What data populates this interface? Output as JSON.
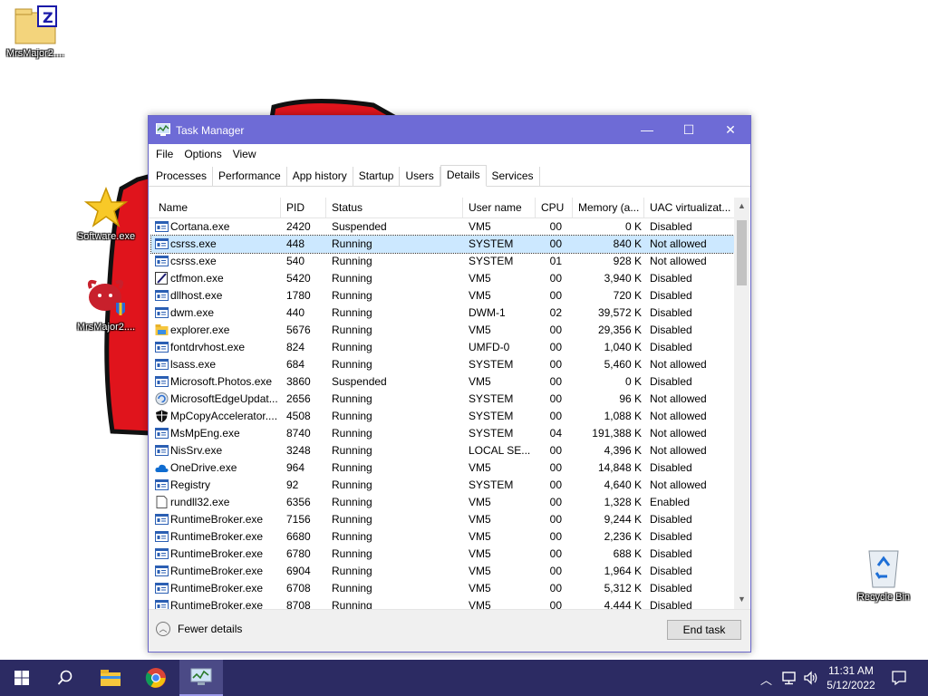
{
  "desktop": {
    "icons": [
      {
        "label": "MrsMajor2...."
      },
      {
        "label": "Software.exe"
      },
      {
        "label": "MrsMajor2...."
      },
      {
        "label": "Recycle Bin"
      }
    ]
  },
  "window": {
    "title": "Task Manager",
    "controls": {
      "minimize": "—",
      "maximize": "☐",
      "close": "✕"
    },
    "menu": [
      "File",
      "Options",
      "View"
    ],
    "tabs": [
      "Processes",
      "Performance",
      "App history",
      "Startup",
      "Users",
      "Details",
      "Services"
    ],
    "active_tab": "Details",
    "columns": [
      "Name",
      "PID",
      "Status",
      "User name",
      "CPU",
      "Memory (a...",
      "UAC virtualizat..."
    ],
    "sort_indicator": "^",
    "rows": [
      {
        "name": "Cortana.exe",
        "pid": "2420",
        "status": "Suspended",
        "user": "VM5",
        "cpu": "00",
        "mem": "0 K",
        "uac": "Disabled",
        "icon": "generic-app"
      },
      {
        "name": "csrss.exe",
        "pid": "448",
        "status": "Running",
        "user": "SYSTEM",
        "cpu": "00",
        "mem": "840 K",
        "uac": "Not allowed",
        "icon": "generic-app"
      },
      {
        "name": "csrss.exe",
        "pid": "540",
        "status": "Running",
        "user": "SYSTEM",
        "cpu": "01",
        "mem": "928 K",
        "uac": "Not allowed",
        "icon": "generic-app"
      },
      {
        "name": "ctfmon.exe",
        "pid": "5420",
        "status": "Running",
        "user": "VM5",
        "cpu": "00",
        "mem": "3,940 K",
        "uac": "Disabled",
        "icon": "pen"
      },
      {
        "name": "dllhost.exe",
        "pid": "1780",
        "status": "Running",
        "user": "VM5",
        "cpu": "00",
        "mem": "720 K",
        "uac": "Disabled",
        "icon": "generic-app"
      },
      {
        "name": "dwm.exe",
        "pid": "440",
        "status": "Running",
        "user": "DWM-1",
        "cpu": "02",
        "mem": "39,572 K",
        "uac": "Disabled",
        "icon": "generic-app"
      },
      {
        "name": "explorer.exe",
        "pid": "5676",
        "status": "Running",
        "user": "VM5",
        "cpu": "00",
        "mem": "29,356 K",
        "uac": "Disabled",
        "icon": "folder"
      },
      {
        "name": "fontdrvhost.exe",
        "pid": "824",
        "status": "Running",
        "user": "UMFD-0",
        "cpu": "00",
        "mem": "1,040 K",
        "uac": "Disabled",
        "icon": "generic-app"
      },
      {
        "name": "lsass.exe",
        "pid": "684",
        "status": "Running",
        "user": "SYSTEM",
        "cpu": "00",
        "mem": "5,460 K",
        "uac": "Not allowed",
        "icon": "generic-app"
      },
      {
        "name": "Microsoft.Photos.exe",
        "pid": "3860",
        "status": "Suspended",
        "user": "VM5",
        "cpu": "00",
        "mem": "0 K",
        "uac": "Disabled",
        "icon": "generic-app"
      },
      {
        "name": "MicrosoftEdgeUpdat...",
        "pid": "2656",
        "status": "Running",
        "user": "SYSTEM",
        "cpu": "00",
        "mem": "96 K",
        "uac": "Not allowed",
        "icon": "edge-update"
      },
      {
        "name": "MpCopyAccelerator....",
        "pid": "4508",
        "status": "Running",
        "user": "SYSTEM",
        "cpu": "00",
        "mem": "1,088 K",
        "uac": "Not allowed",
        "icon": "shield"
      },
      {
        "name": "MsMpEng.exe",
        "pid": "8740",
        "status": "Running",
        "user": "SYSTEM",
        "cpu": "04",
        "mem": "191,388 K",
        "uac": "Not allowed",
        "icon": "generic-app"
      },
      {
        "name": "NisSrv.exe",
        "pid": "3248",
        "status": "Running",
        "user": "LOCAL SE...",
        "cpu": "00",
        "mem": "4,396 K",
        "uac": "Not allowed",
        "icon": "generic-app"
      },
      {
        "name": "OneDrive.exe",
        "pid": "964",
        "status": "Running",
        "user": "VM5",
        "cpu": "00",
        "mem": "14,848 K",
        "uac": "Disabled",
        "icon": "cloud"
      },
      {
        "name": "Registry",
        "pid": "92",
        "status": "Running",
        "user": "SYSTEM",
        "cpu": "00",
        "mem": "4,640 K",
        "uac": "Not allowed",
        "icon": "generic-app"
      },
      {
        "name": "rundll32.exe",
        "pid": "6356",
        "status": "Running",
        "user": "VM5",
        "cpu": "00",
        "mem": "1,328 K",
        "uac": "Enabled",
        "icon": "document"
      },
      {
        "name": "RuntimeBroker.exe",
        "pid": "7156",
        "status": "Running",
        "user": "VM5",
        "cpu": "00",
        "mem": "9,244 K",
        "uac": "Disabled",
        "icon": "generic-app"
      },
      {
        "name": "RuntimeBroker.exe",
        "pid": "6680",
        "status": "Running",
        "user": "VM5",
        "cpu": "00",
        "mem": "2,236 K",
        "uac": "Disabled",
        "icon": "generic-app"
      },
      {
        "name": "RuntimeBroker.exe",
        "pid": "6780",
        "status": "Running",
        "user": "VM5",
        "cpu": "00",
        "mem": "688 K",
        "uac": "Disabled",
        "icon": "generic-app"
      },
      {
        "name": "RuntimeBroker.exe",
        "pid": "6904",
        "status": "Running",
        "user": "VM5",
        "cpu": "00",
        "mem": "1,964 K",
        "uac": "Disabled",
        "icon": "generic-app"
      },
      {
        "name": "RuntimeBroker.exe",
        "pid": "6708",
        "status": "Running",
        "user": "VM5",
        "cpu": "00",
        "mem": "5,312 K",
        "uac": "Disabled",
        "icon": "generic-app"
      },
      {
        "name": "RuntimeBroker.exe",
        "pid": "8708",
        "status": "Running",
        "user": "VM5",
        "cpu": "00",
        "mem": "4,444 K",
        "uac": "Disabled",
        "icon": "generic-app"
      }
    ],
    "selected_row": 1,
    "footer": {
      "fewer_details": "Fewer details",
      "end_task": "End task"
    }
  },
  "taskbar": {
    "apps": [
      "windows-start-icon",
      "search-icon",
      "file-explorer-icon",
      "chrome-icon",
      "task-manager-icon"
    ],
    "tray_icons": [
      "chevron-up-icon",
      "network-icon",
      "volume-icon"
    ],
    "time": "11:31 AM",
    "date": "5/12/2022"
  },
  "colors": {
    "title_bar": "#6e6bd6",
    "taskbar": "#2c2b63",
    "selection": "#cce8ff",
    "art_red": "#e0141c"
  }
}
